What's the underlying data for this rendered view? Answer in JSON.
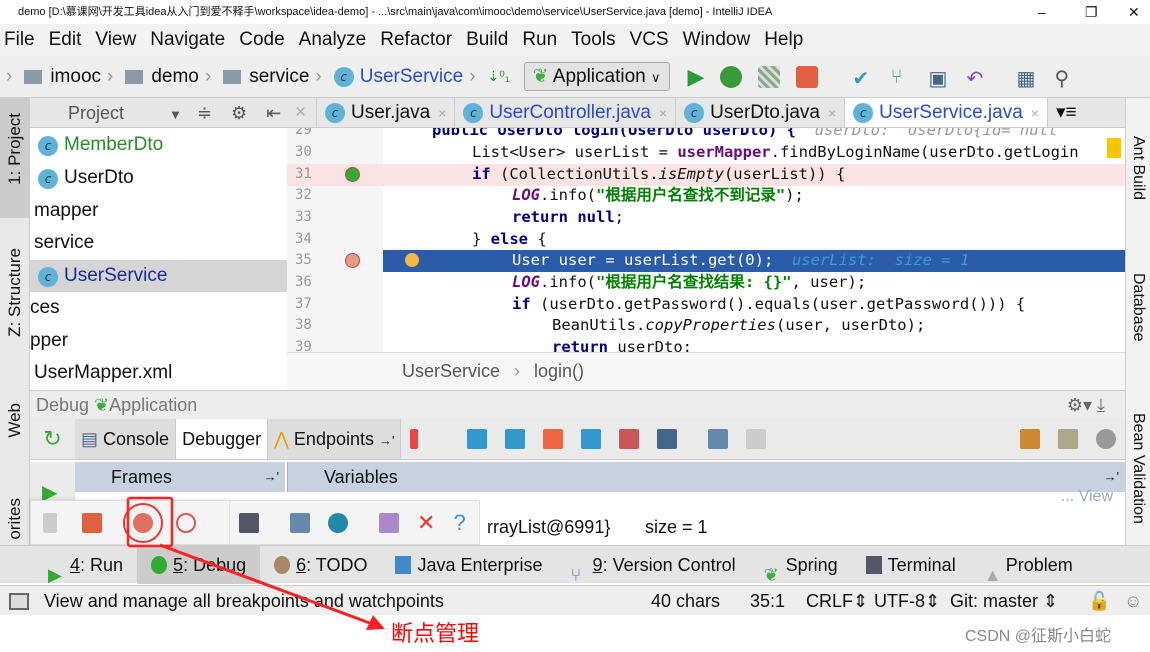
{
  "window": {
    "title": "demo [D:\\慕课网\\开发工具idea从入门到爱不释手\\workspace\\idea-demo] - ...\\src\\main\\java\\com\\imooc\\demo\\service\\UserService.java [demo] - IntelliJ IDEA",
    "minimize": "–",
    "restore": "❐",
    "close": "✕"
  },
  "menu": [
    "File",
    "Edit",
    "View",
    "Navigate",
    "Code",
    "Analyze",
    "Refactor",
    "Build",
    "Run",
    "Tools",
    "VCS",
    "Window",
    "Help"
  ],
  "nav": {
    "crumbs": [
      "imooc",
      "demo",
      "service",
      "UserService"
    ],
    "run_config": "Application"
  },
  "left_strip": {
    "project": "1: Project",
    "structure": "Z: Structure",
    "web": "Web",
    "favorites": "orites"
  },
  "right_strip": {
    "ant": "Ant Build",
    "database": "Database",
    "bean": "Bean Validation"
  },
  "project": {
    "title": "Project",
    "items": [
      {
        "label": "MemberDto",
        "type": "class",
        "color": "#2a8a2a"
      },
      {
        "label": "UserDto",
        "type": "class"
      },
      {
        "label": "mapper",
        "type": "folder"
      },
      {
        "label": "service",
        "type": "folder"
      },
      {
        "label": "UserService",
        "type": "class",
        "selected": true
      },
      {
        "label": "ces",
        "type": "folder"
      },
      {
        "label": "pper",
        "type": "folder"
      },
      {
        "label": "UserMapper.xml",
        "type": "file"
      }
    ]
  },
  "tabs": [
    {
      "label": "User.java"
    },
    {
      "label": "UserController.java"
    },
    {
      "label": "UserDto.java"
    },
    {
      "label": "UserService.java",
      "active": true
    }
  ],
  "editor": {
    "lines": {
      "l29": "29",
      "l30": "30",
      "l31": "31",
      "l32": "32",
      "l33": "33",
      "l34": "34",
      "l35": "35",
      "l36": "36",
      "l37": "37",
      "l38": "38",
      "l39": "39"
    },
    "c29a": "public UserDto login(UserDto userDto) {",
    "c29b": "userDto: \"UserDto{id= null",
    "c30a": "List<User> userList = ",
    "c30b": "userMapper",
    ".c30c": "",
    "c30d": ".findByLoginName(userDto.getLogin",
    "c31a": "if ",
    "c31b": "(CollectionUtils.",
    "c31c": "isEmpty",
    "c31d": "(userList)) {",
    "c32a": "LOG",
    "c32b": ".info(",
    "c32c": "\"根据用户名查找不到记录\"",
    "c32d": ");",
    "c33a": "return null",
    "c33b": ";",
    "c34a": "} ",
    "c34b": "else",
    " c34c": " {",
    "c35a": "User user = userList.get(0);",
    "c35b": "userList:  size = 1",
    "c36a": "LOG",
    "c36b": ".info(",
    "c36c": "\"根据用户名查找结果: {}\"",
    "c36d": ", user);",
    "c37a": "if ",
    "c37b": "(userDto.getPassword().equals(user.getPassword())) {",
    "c38a": "BeanUtils.",
    "c38b": "copyProperties",
    "c38c": "(user, userDto);",
    "c39a": "return ",
    "c39b": "userDto;",
    "breadcrumb": [
      "UserService",
      "login()"
    ]
  },
  "debug": {
    "title": "Debug",
    "config": "Application",
    "tabs": [
      "Console",
      "Debugger",
      "Endpoints"
    ],
    "frames": "Frames",
    "variables": "Variables",
    "var_value": "rrayList@6991}",
    "var_size": "size = 1",
    "view": "... View"
  },
  "toolwindows": [
    {
      "num": "4",
      "label": ": Run"
    },
    {
      "num": "5",
      "label": ": Debug",
      "active": true
    },
    {
      "num": "6",
      "label": ": TODO"
    },
    {
      "num": "",
      "label": "Java Enterprise"
    },
    {
      "num": "9",
      "label": ": Version Control"
    },
    {
      "num": "",
      "label": "Spring"
    },
    {
      "num": "",
      "label": "Terminal"
    },
    {
      "num": "",
      "label": "Problem"
    }
  ],
  "status": {
    "message": "View and manage all breakpoints and watchpoints",
    "chars": "40 chars",
    "pos": "35:1",
    "line_sep": "CRLF",
    "encoding": "UTF-8",
    "git": "Git: master"
  },
  "annotation": "断点管理",
  "watermark": "CSDN @征斯小白蛇"
}
